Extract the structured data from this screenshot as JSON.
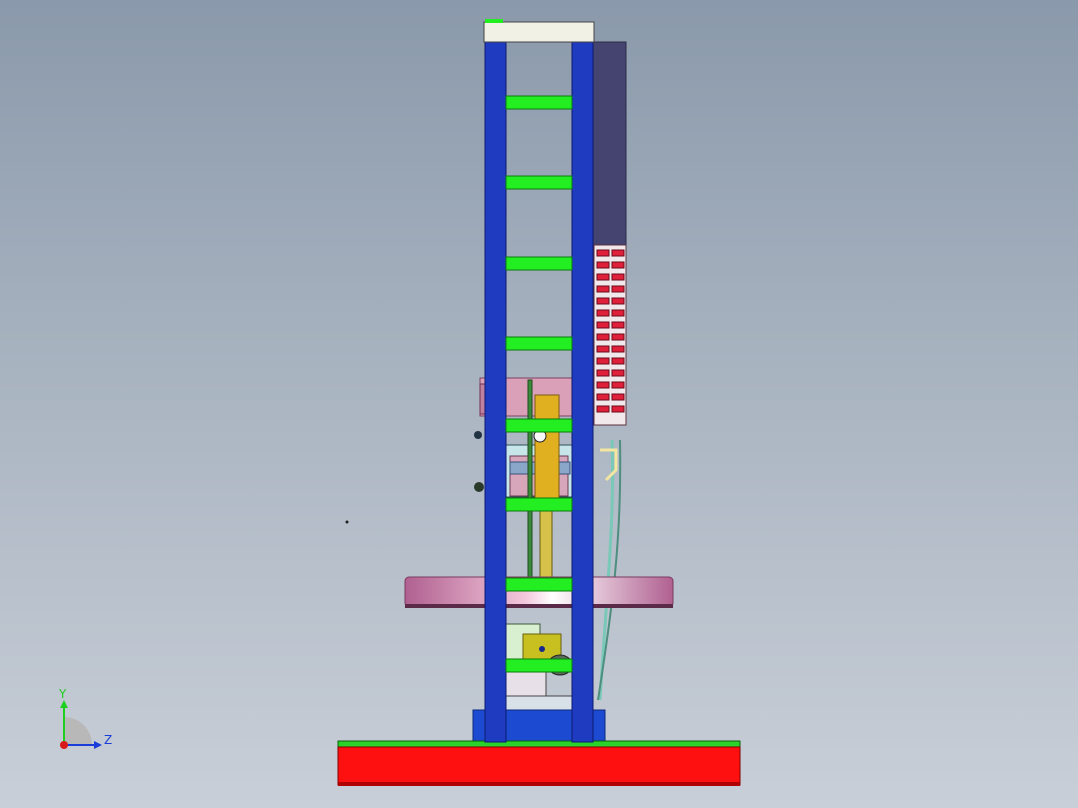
{
  "triad": {
    "y_label": "Y",
    "z_label": "Z",
    "y_color": "#1fcf1f",
    "z_color": "#1a3cd8",
    "x_color": "#d81a1a"
  },
  "colors": {
    "frame": "#1f3cc0",
    "crossbar": "#22ee22",
    "base_beam": "#ff1010",
    "base_block": "#1c4ad0",
    "turntable": "#d07ab0",
    "chain": "#e0203a",
    "panel": "#454470",
    "cap": "#f2f1e6",
    "cylinder": "#e0b020",
    "carriage": "#b6dce0"
  }
}
